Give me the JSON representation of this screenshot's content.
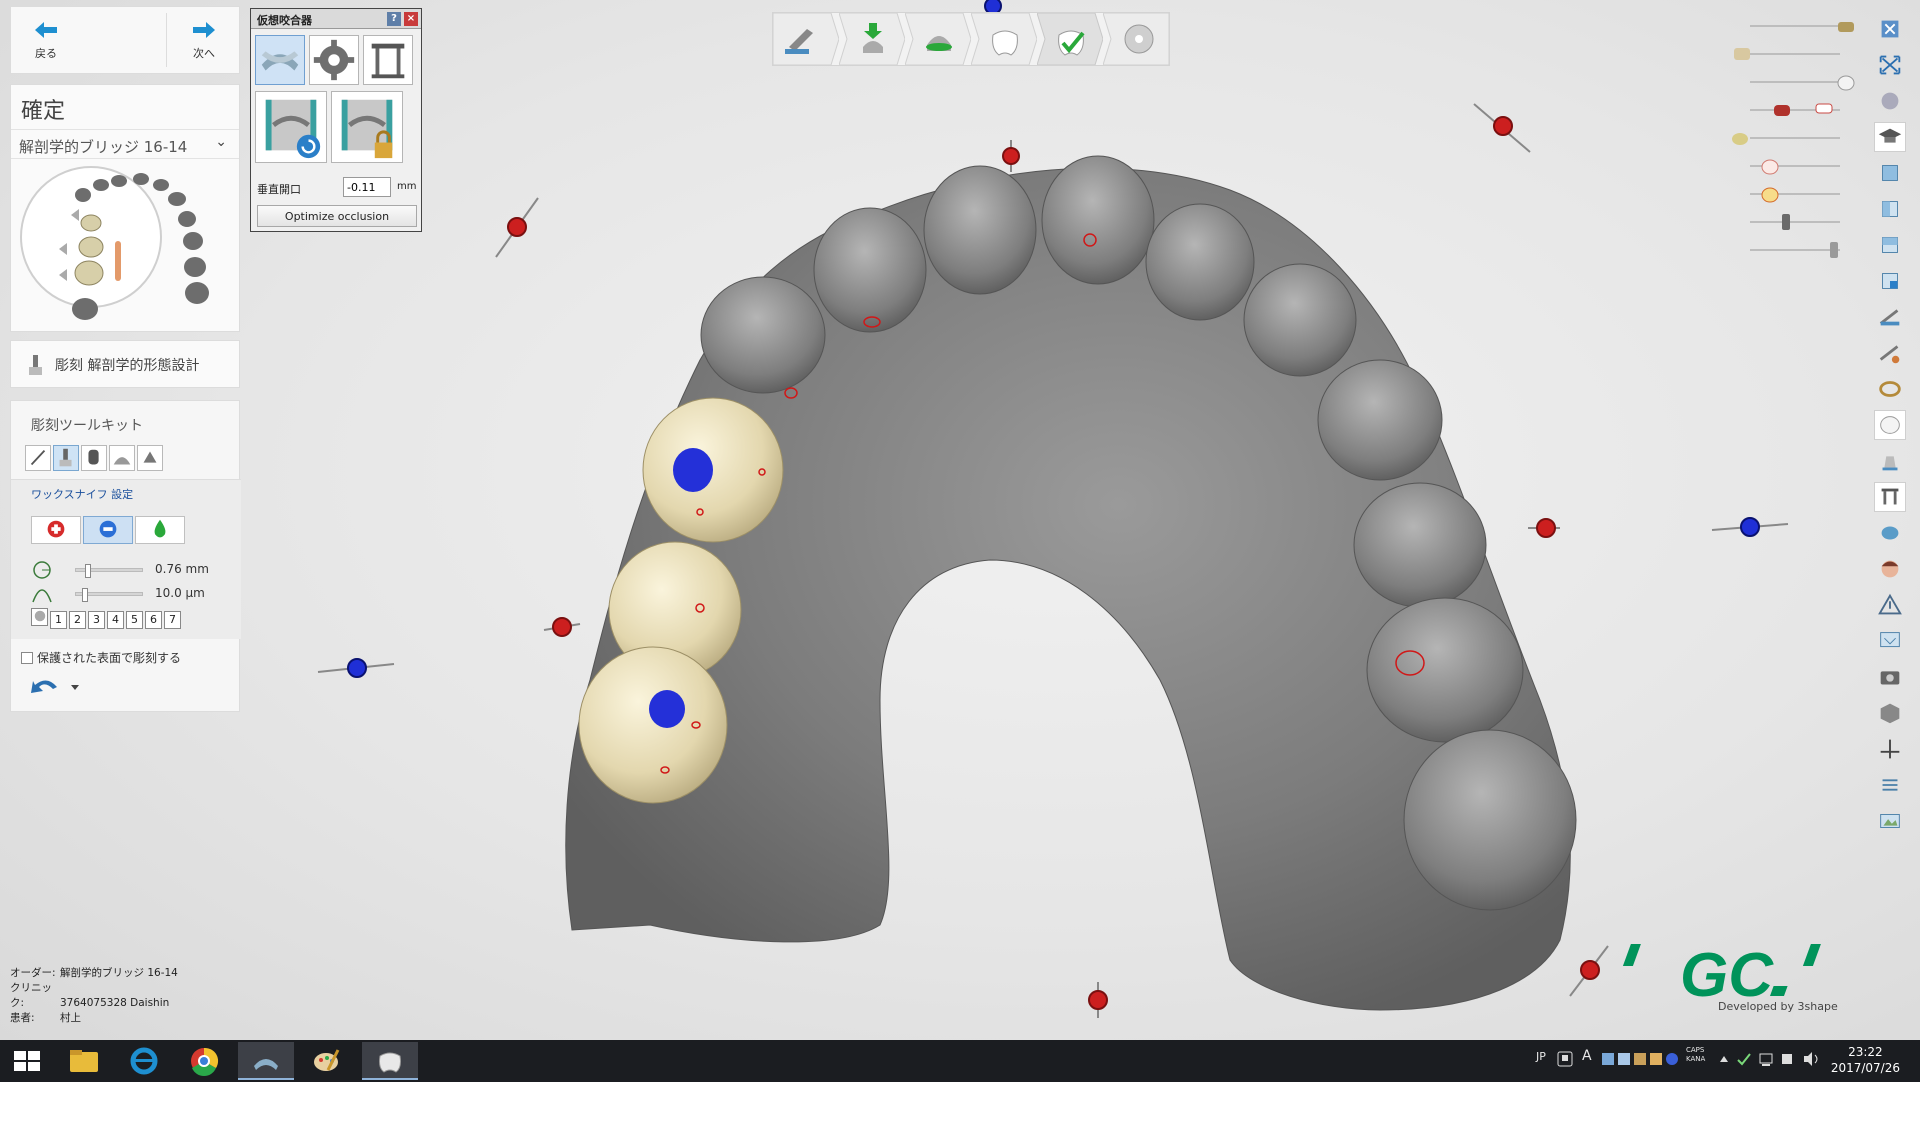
{
  "nav": {
    "back_label": "戻る",
    "next_label": "次へ"
  },
  "confirm": {
    "title": "確定",
    "order_selector": "解剖学的ブリッジ 16-14"
  },
  "sculpt_mode": {
    "label": "彫刻 解剖学的形態設計"
  },
  "toolkit": {
    "title": "彫刻ツールキット",
    "sub_title": "ワックスナイフ  設定",
    "slider_size_value": "0.76 mm",
    "slider_size_fraction": 0.15,
    "slider_strength_value": "10.0 µm",
    "slider_strength_fraction": 0.1,
    "presets": [
      "1",
      "2",
      "3",
      "4",
      "5",
      "6",
      "7"
    ],
    "protect_label": "保護された表面で彫刻する"
  },
  "articulator": {
    "title": "仮想咬合器",
    "help": "?",
    "close": "×",
    "vertical_label": "垂直開口",
    "vertical_value": "-0.11",
    "vertical_unit": "mm",
    "optimize_label": "Optimize occlusion"
  },
  "info": {
    "order_label": "オーダー:",
    "order_value": "解剖学的ブリッジ 16-14",
    "clinic_label": "クリニック:",
    "clinic_value": "3764075328 Daishin",
    "patient_label": "患者:",
    "patient_value": "村上"
  },
  "brand": {
    "logo_text": "GC",
    "developed_by": "Developed by 3shape"
  },
  "taskbar": {
    "lang": "JP",
    "ime": "A",
    "caps": "CAPS",
    "kana": "KANA",
    "time": "23:22",
    "date": "2017/07/26"
  },
  "colors": {
    "crown": "#e7ddb9",
    "model": "#7a7a7a",
    "accent_green": "#00935a",
    "marker_red": "#cc1f1f",
    "marker_blue": "#1f2fd6"
  }
}
